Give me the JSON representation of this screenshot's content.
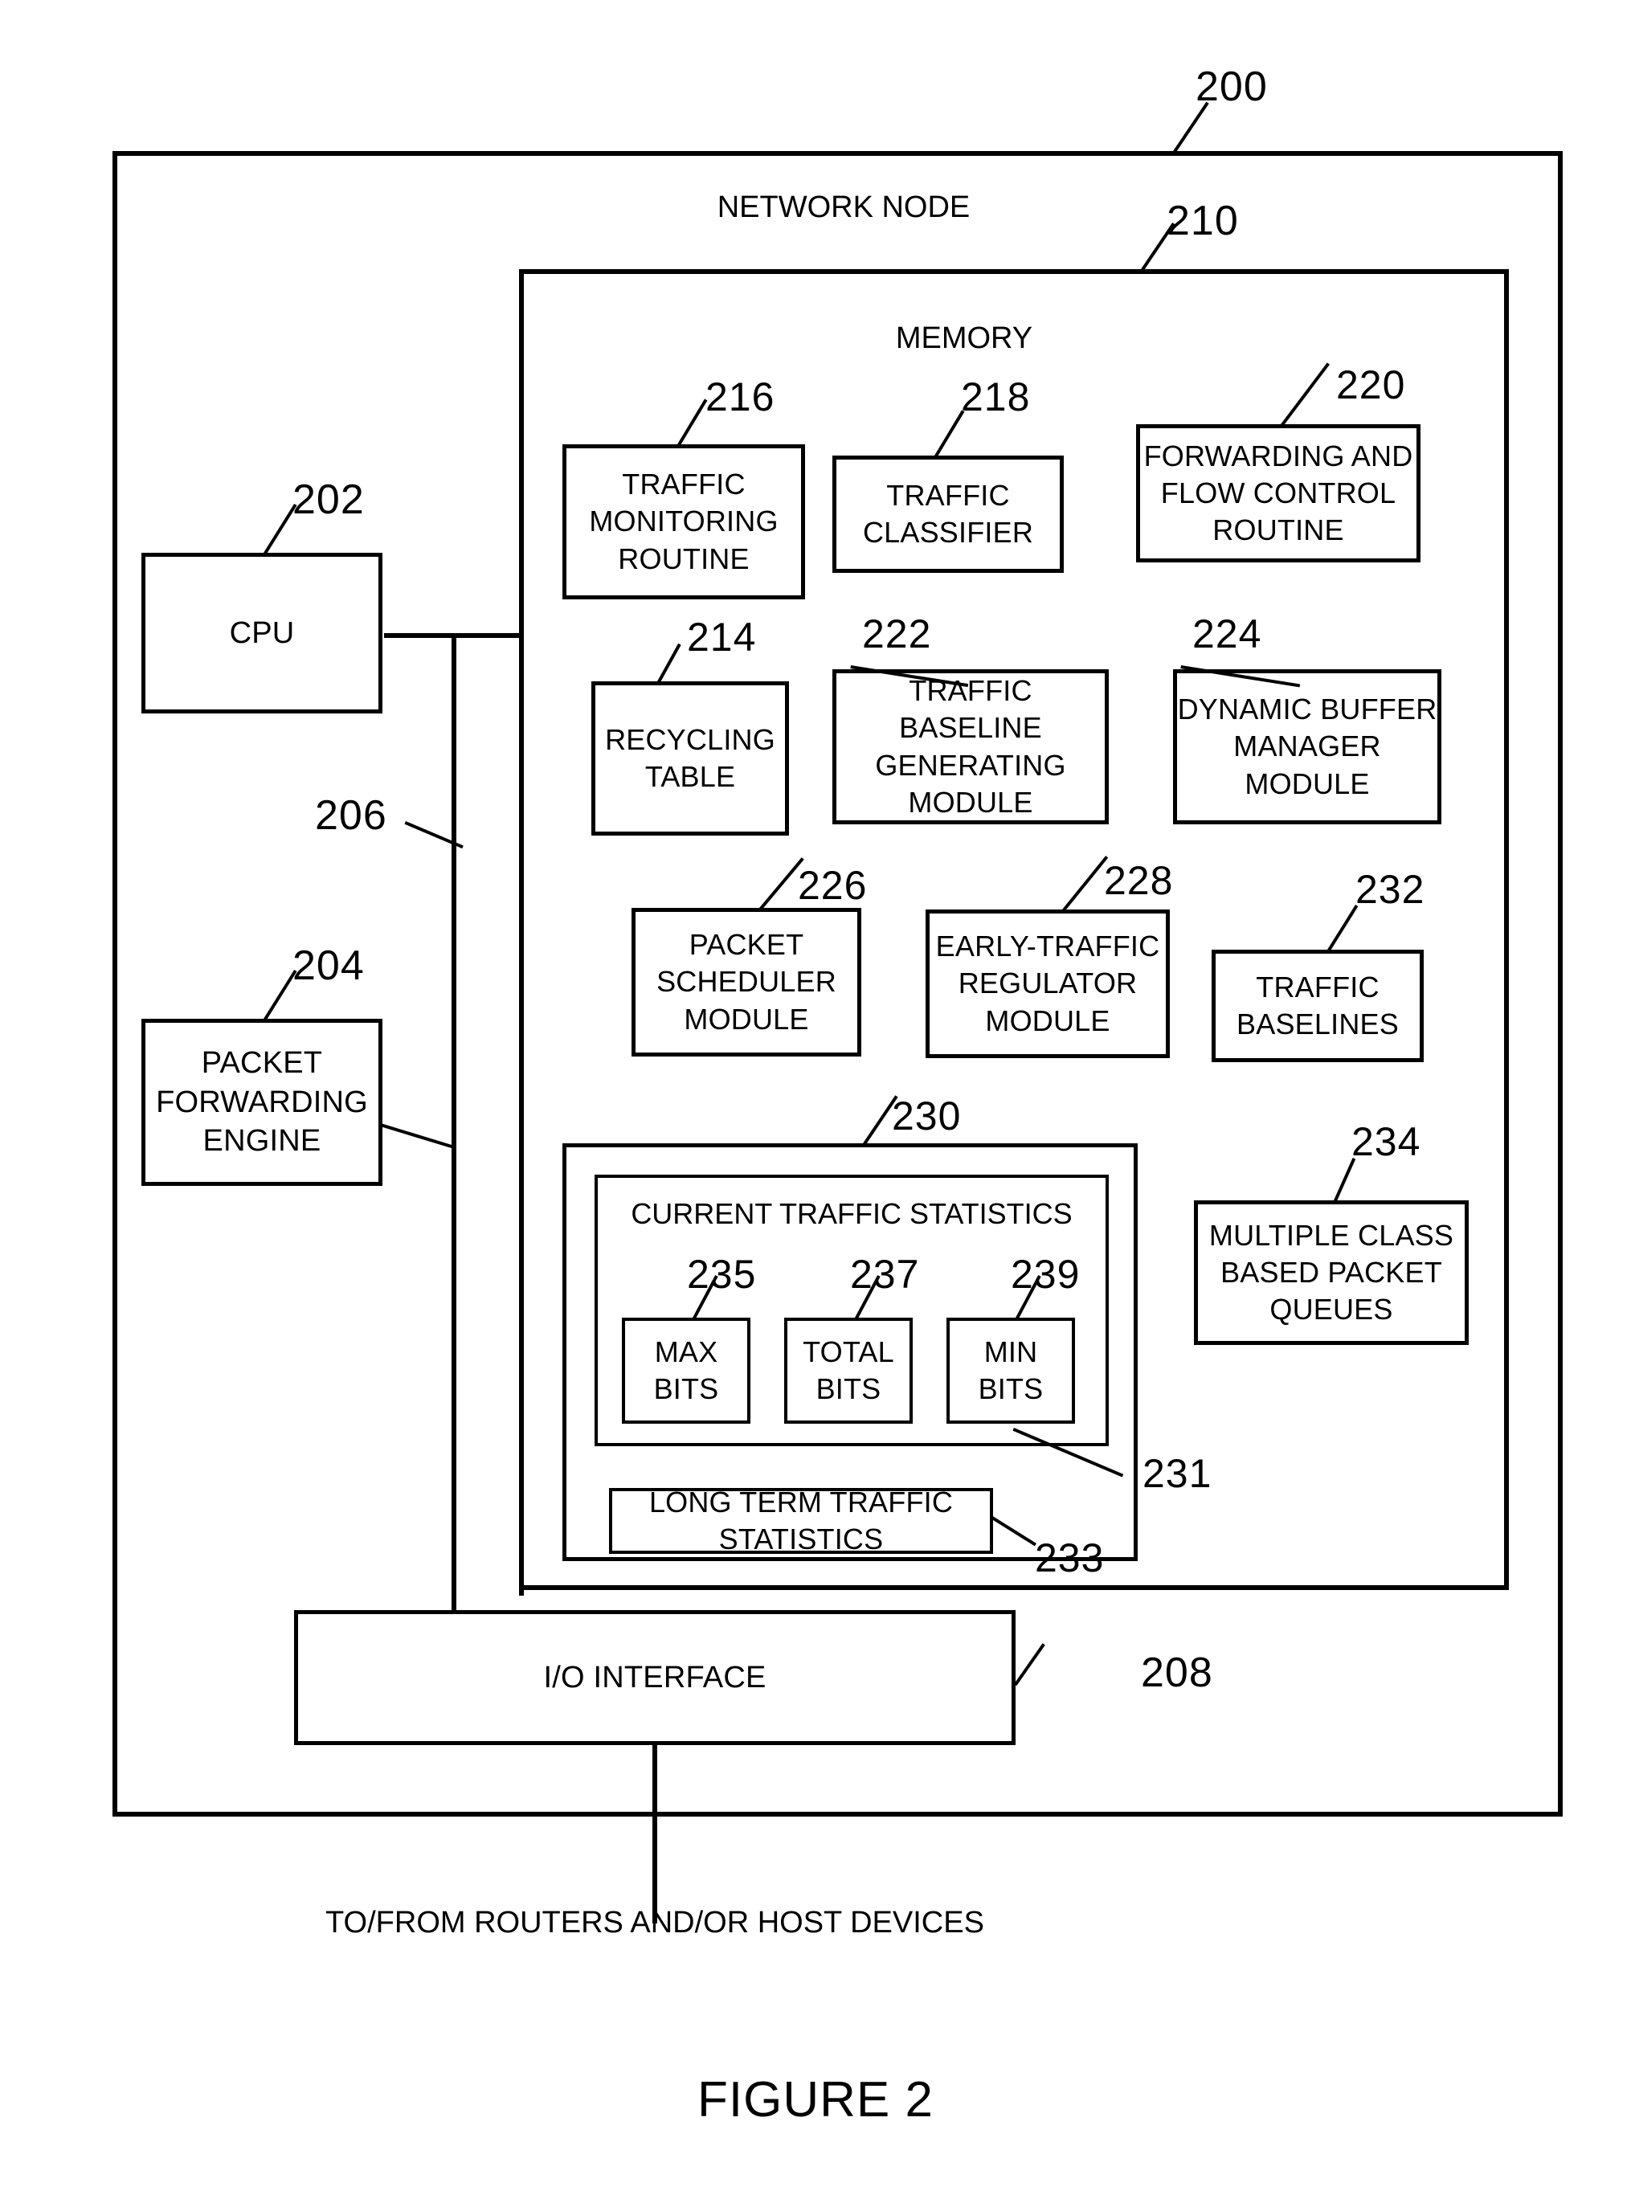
{
  "figure": {
    "caption": "FIGURE 2",
    "outer_ref": "200",
    "outer_title": "NETWORK NODE",
    "memory_ref": "210",
    "memory_title": "MEMORY",
    "bus_ref": "206",
    "io_ref": "208",
    "bottom_note": "TO/FROM ROUTERS AND/OR HOST DEVICES"
  },
  "left_column": {
    "cpu": {
      "ref": "202",
      "label": "CPU"
    },
    "packet_forwarding_engine": {
      "ref": "204",
      "label": "PACKET\nFORWARDING\nENGINE",
      "line1": "PACKET",
      "line2": "FORWARDING",
      "line3": "ENGINE"
    }
  },
  "io_interface": {
    "ref": "208",
    "label": "I/O INTERFACE"
  },
  "memory_modules": {
    "traffic_monitoring_routine": {
      "ref": "216",
      "line1": "TRAFFIC",
      "line2": "MONITORING",
      "line3": "ROUTINE"
    },
    "traffic_classifier": {
      "ref": "218",
      "line1": "TRAFFIC",
      "line2": "CLASSIFIER"
    },
    "forwarding_and_flow_control_routine": {
      "ref": "220",
      "line1": "FORWARDING AND",
      "line2": "FLOW CONTROL",
      "line3": "ROUTINE"
    },
    "recycling_table": {
      "ref": "214",
      "line1": "RECYCLING",
      "line2": "TABLE"
    },
    "traffic_baseline_generating_module": {
      "ref": "222",
      "line1": "TRAFFIC BASELINE",
      "line2": "GENERATING",
      "line3": "MODULE"
    },
    "dynamic_buffer_manager_module": {
      "ref": "224",
      "line1": "DYNAMIC BUFFER",
      "line2": "MANAGER",
      "line3": "MODULE"
    },
    "packet_scheduler_module": {
      "ref": "226",
      "line1": "PACKET",
      "line2": "SCHEDULER",
      "line3": "MODULE"
    },
    "early_traffic_regulator_module": {
      "ref": "228",
      "line1": "EARLY-TRAFFIC",
      "line2": "REGULATOR",
      "line3": "MODULE"
    },
    "traffic_baselines": {
      "ref": "232",
      "line1": "TRAFFIC",
      "line2": "BASELINES"
    },
    "multiple_class_based_packet_queues": {
      "ref": "234",
      "line1": "MULTIPLE CLASS",
      "line2": "BASED PACKET",
      "line3": "QUEUES"
    }
  },
  "statistics_container": {
    "ref": "230",
    "current_traffic_statistics": {
      "ref": "231",
      "title": "CURRENT TRAFFIC STATISTICS",
      "counters": [
        {
          "ref": "235",
          "line1": "MAX",
          "line2": "BITS"
        },
        {
          "ref": "237",
          "line1": "TOTAL",
          "line2": "BITS"
        },
        {
          "ref": "239",
          "line1": "MIN",
          "line2": "BITS"
        }
      ]
    },
    "long_term_traffic_statistics": {
      "ref": "233",
      "line1": "LONG TERM TRAFFIC",
      "line2": "STATISTICS"
    }
  }
}
